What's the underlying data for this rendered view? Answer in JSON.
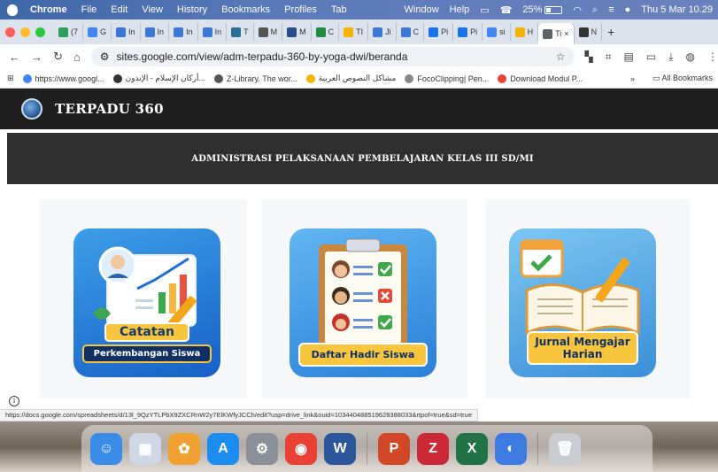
{
  "menubar": {
    "app": "Chrome",
    "items": [
      "File",
      "Edit",
      "View",
      "History",
      "Bookmarks",
      "Profiles",
      "Tab"
    ],
    "right_items": [
      "Window",
      "Help"
    ],
    "battery": "25%",
    "datetime": "Thu 5 Mar 10.29"
  },
  "tabs": [
    {
      "label": "(7",
      "color": "#2e9e5a"
    },
    {
      "label": "G",
      "color": "#4285f4"
    },
    {
      "label": "In",
      "color": "#3c78d8"
    },
    {
      "label": "In",
      "color": "#3c78d8"
    },
    {
      "label": "In",
      "color": "#3c78d8"
    },
    {
      "label": "In",
      "color": "#3c78d8"
    },
    {
      "label": "T",
      "color": "#2a6f97"
    },
    {
      "label": "M",
      "color": "#555555"
    },
    {
      "label": "M",
      "color": "#2b4c8c"
    },
    {
      "label": "C",
      "color": "#1e8e3e"
    },
    {
      "label": "TI",
      "color": "#f4b400"
    },
    {
      "label": "Ji",
      "color": "#3c78d8"
    },
    {
      "label": "C",
      "color": "#3c78d8"
    },
    {
      "label": "Pi",
      "color": "#1a73e8"
    },
    {
      "label": "Pi",
      "color": "#1a73e8"
    },
    {
      "label": "si",
      "color": "#4285f4"
    },
    {
      "label": "H",
      "color": "#f4b400"
    },
    {
      "label": "Ti",
      "color": "#5f6368",
      "active": true
    },
    {
      "label": "N",
      "color": "#333333"
    }
  ],
  "address": {
    "url": "sites.google.com/view/adm-terpadu-360-by-yoga-dwi/beranda"
  },
  "bookmarks": [
    {
      "label": "https://www.googl...",
      "color": "#4285f4"
    },
    {
      "label": "أركان الإسلام - الإندون...",
      "color": "#333333"
    },
    {
      "label": "Z-Library. The wor...",
      "color": "#555555"
    },
    {
      "label": "مشاكل النصوص العربية",
      "color": "#f4b400"
    },
    {
      "label": "FocoClipping| Pen...",
      "color": "#888888"
    },
    {
      "label": "Download Modul P...",
      "color": "#ea4335"
    }
  ],
  "bookmarks_all": "All Bookmarks",
  "bookmarks_more": "»",
  "site": {
    "title": "TERPADU 360",
    "subtitle": "ADMINISTRASI PELAKSANAAN PEMBELAJARAN KELAS III SD/MI"
  },
  "cards": [
    {
      "line1": "Catatan",
      "line2": "Perkembangan Siswa"
    },
    {
      "line1": "Daftar Hadir Siswa"
    },
    {
      "line1": "Jurnal Mengajar",
      "line2": "Harian"
    }
  ],
  "status_url": "https://docs.google.com/spreadsheets/d/13l_9QzYTLPbX9ZXCRnW2y7ElKWfyJCCh/edit?usp=drive_link&ouid=103440488519628388033&rtpof=true&sd=true",
  "dock": [
    {
      "name": "finder",
      "color": "#3b8be8",
      "glyph": "☺"
    },
    {
      "name": "launchpad",
      "color": "#cfd6e4",
      "glyph": "▦"
    },
    {
      "name": "photos",
      "color": "#f0a030",
      "glyph": "✿"
    },
    {
      "name": "app-store",
      "color": "#1d8cf0",
      "glyph": "A"
    },
    {
      "name": "system-settings",
      "color": "#8a8f98",
      "glyph": "⚙"
    },
    {
      "name": "chrome",
      "color": "#e94235",
      "glyph": "◉"
    },
    {
      "name": "word",
      "color": "#2b579a",
      "glyph": "W"
    },
    {
      "name": "powerpoint",
      "color": "#d24726",
      "glyph": "P"
    },
    {
      "name": "zotero",
      "color": "#cc2936",
      "glyph": "Z"
    },
    {
      "name": "excel",
      "color": "#217346",
      "glyph": "X"
    },
    {
      "name": "preview",
      "color": "#3d7be0",
      "glyph": "◐"
    },
    {
      "name": "trash",
      "color": "#c9ccd1",
      "glyph": "🗑"
    }
  ]
}
